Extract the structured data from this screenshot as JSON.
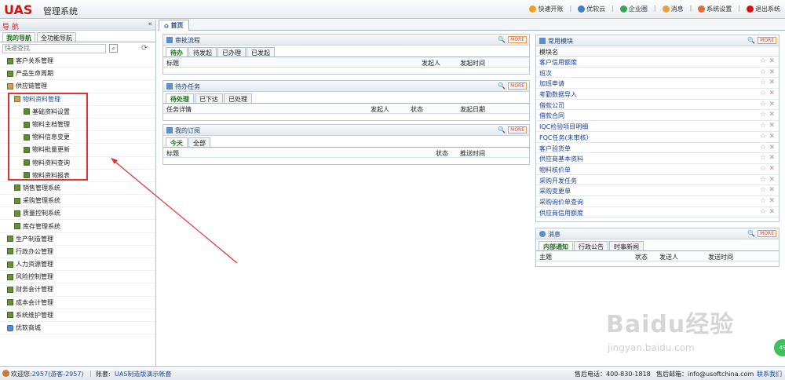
{
  "header": {
    "logo": "UAS",
    "system_name": "管理系统",
    "menu": [
      "快速开账",
      "优软云",
      "企业圈",
      "消息",
      "系统设置",
      "退出系统"
    ]
  },
  "nav": {
    "title": "导 航",
    "collapse_icon": "«",
    "tabs": [
      "我的导航",
      "全功能导航"
    ],
    "search_placeholder": "快速查找",
    "tree": [
      {
        "label": "客户关系管理",
        "level": 0
      },
      {
        "label": "产品生命周期",
        "level": 0
      },
      {
        "label": "供应链管理",
        "level": 0,
        "open": true
      },
      {
        "label": "物料资料管理",
        "level": 1,
        "open": true,
        "selected": true
      },
      {
        "label": "基础资料设置",
        "level": 2
      },
      {
        "label": "物料主档管理",
        "level": 2
      },
      {
        "label": "物料信息变更",
        "level": 2
      },
      {
        "label": "物料批量更新",
        "level": 2
      },
      {
        "label": "物料资料查询",
        "level": 2
      },
      {
        "label": "物料资料报表",
        "level": 2
      },
      {
        "label": "销售管理系统",
        "level": 1
      },
      {
        "label": "采购管理系统",
        "level": 1
      },
      {
        "label": "质量控制系统",
        "level": 1
      },
      {
        "label": "库存管理系统",
        "level": 1
      },
      {
        "label": "生产制造管理",
        "level": 0
      },
      {
        "label": "行政办公管理",
        "level": 0
      },
      {
        "label": "人力资源管理",
        "level": 0
      },
      {
        "label": "风险控制管理",
        "level": 0
      },
      {
        "label": "财务会计管理",
        "level": 0
      },
      {
        "label": "成本会计管理",
        "level": 0
      },
      {
        "label": "系统维护管理",
        "level": 0
      },
      {
        "label": "优软商城",
        "level": 0,
        "globe": true
      }
    ]
  },
  "main": {
    "home_tab": "首页",
    "more_label": "MORE",
    "approval": {
      "title": "审批流程",
      "tabs": [
        "待办",
        "待发起",
        "已办理",
        "已发起"
      ],
      "columns": [
        "标题",
        "发起人",
        "发起时间"
      ]
    },
    "tasks": {
      "title": "待办任务",
      "tabs": [
        "待处理",
        "已下达",
        "已处理"
      ],
      "columns": [
        "任务详情",
        "发起人",
        "状态",
        "发起日期"
      ]
    },
    "subscribe": {
      "title": "我的订阅",
      "tabs": [
        "今天",
        "全部"
      ],
      "columns": [
        "标题",
        "状态",
        "推送时间"
      ]
    },
    "modules": {
      "title": "常用模块",
      "column": "模块名",
      "items": [
        "客户信用额度",
        "班次",
        "加班申请",
        "考勤数据导入",
        "借款公司",
        "借款合同",
        "IQC检验项目明细",
        "FQC任务(未审核）",
        "客户验货单",
        "供应商基本资料",
        "物料核价单",
        "采购开发任务",
        "采购变更单",
        "采购询价单查询",
        "供应商信用额度"
      ]
    },
    "messages": {
      "title": "消息",
      "tabs": [
        "内部通知",
        "行政公告",
        "时事新闻"
      ],
      "columns": [
        "主题",
        "状态",
        "发送人",
        "发送时间"
      ]
    }
  },
  "status": {
    "welcome_prefix": "欢迎您:",
    "user": "2957(游客-2957)",
    "account_label": "账套:",
    "account": "UAS制造版演示帐套",
    "hotline": "售后电话：400-830-1818",
    "email": "售后邮箱：info@usoftchina.com",
    "contact": "联系我们"
  },
  "watermark": {
    "brand": "Baidu经验",
    "url": "jingyan.baidu.com"
  },
  "float_button": "49"
}
